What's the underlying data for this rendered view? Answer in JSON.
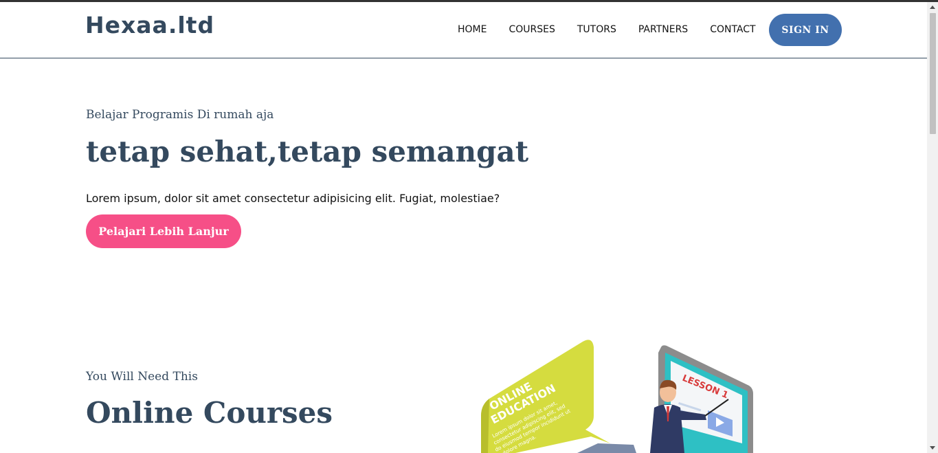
{
  "brand": {
    "logo": "Hexaa.ltd"
  },
  "nav": {
    "items": [
      "HOME",
      "COURSES",
      "TUTORS",
      "PARTNERS",
      "CONTACT"
    ],
    "signin_label": "SIGN IN"
  },
  "hero": {
    "subtitle": "Belajar Programis Di rumah aja",
    "title": "tetap sehat,tetap semangat",
    "text": "Lorem ipsum, dolor sit amet consectetur adipisicing elit. Fugiat, molestiae?",
    "cta_label": "Pelajari Lebih Lanjur"
  },
  "courses": {
    "subtitle": "You Will Need This",
    "title": "Online Courses",
    "illustration": {
      "bubble_title_1": "ONLINE",
      "bubble_title_2": "EDUCATION",
      "bubble_text_1": "Lorem ipsum dolor sit amet,",
      "bubble_text_2": "consectetur adipiscing elit, sed",
      "bubble_text_3": "do eiusmod tempor incididunt ut",
      "bubble_text_4": "et dolore magna.",
      "screen_label": "LESSON 1"
    }
  },
  "colors": {
    "primary": "#34495e",
    "signin": "#4270ae",
    "cta": "#f64f87",
    "bubble": "#d5dc3f"
  }
}
